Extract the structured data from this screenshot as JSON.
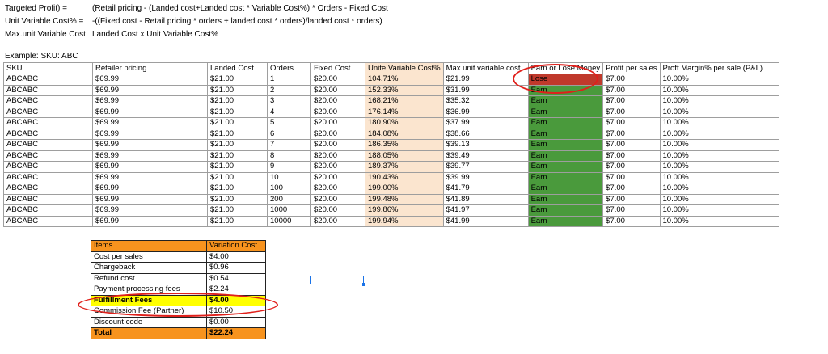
{
  "formulas": [
    {
      "label": "Targeted Profit) =",
      "value": "(Retail pricing - (Landed cost+Landed cost * Variable Cost%) * Orders - Fixed Cost"
    },
    {
      "label": "Unit Variable Cost% =",
      "value": "-((Fixed cost - Retail pricing * orders + landed cost * orders)/landed cost * orders)"
    },
    {
      "label": "Max.unit Variable Cost",
      "value": "Landed Cost x Unit Variable Cost%"
    }
  ],
  "example_label": "Example: SKU: ABC",
  "main_table": {
    "headers": [
      "SKU",
      "Retailer pricing",
      "Landed Cost",
      "Orders",
      "Fixed Cost",
      "Unite Variable Cost%",
      "Max.unit variable cost",
      "Earn or Lose Money",
      "Profit per sales",
      "Proft Margin% per sale (P&L)"
    ],
    "rows": [
      [
        "ABCABC",
        "$69.99",
        "$21.00",
        "1",
        "$20.00",
        "104.71%",
        "$21.99",
        "Lose",
        "$7.00",
        "10.00%"
      ],
      [
        "ABCABC",
        "$69.99",
        "$21.00",
        "2",
        "$20.00",
        "152.33%",
        "$31.99",
        "Earn",
        "$7.00",
        "10.00%"
      ],
      [
        "ABCABC",
        "$69.99",
        "$21.00",
        "3",
        "$20.00",
        "168.21%",
        "$35.32",
        "Earn",
        "$7.00",
        "10.00%"
      ],
      [
        "ABCABC",
        "$69.99",
        "$21.00",
        "4",
        "$20.00",
        "176.14%",
        "$36.99",
        "Earn",
        "$7.00",
        "10.00%"
      ],
      [
        "ABCABC",
        "$69.99",
        "$21.00",
        "5",
        "$20.00",
        "180.90%",
        "$37.99",
        "Earn",
        "$7.00",
        "10.00%"
      ],
      [
        "ABCABC",
        "$69.99",
        "$21.00",
        "6",
        "$20.00",
        "184.08%",
        "$38.66",
        "Earn",
        "$7.00",
        "10.00%"
      ],
      [
        "ABCABC",
        "$69.99",
        "$21.00",
        "7",
        "$20.00",
        "186.35%",
        "$39.13",
        "Earn",
        "$7.00",
        "10.00%"
      ],
      [
        "ABCABC",
        "$69.99",
        "$21.00",
        "8",
        "$20.00",
        "188.05%",
        "$39.49",
        "Earn",
        "$7.00",
        "10.00%"
      ],
      [
        "ABCABC",
        "$69.99",
        "$21.00",
        "9",
        "$20.00",
        "189.37%",
        "$39.77",
        "Earn",
        "$7.00",
        "10.00%"
      ],
      [
        "ABCABC",
        "$69.99",
        "$21.00",
        "10",
        "$20.00",
        "190.43%",
        "$39.99",
        "Earn",
        "$7.00",
        "10.00%"
      ],
      [
        "ABCABC",
        "$69.99",
        "$21.00",
        "100",
        "$20.00",
        "199.00%",
        "$41.79",
        "Earn",
        "$7.00",
        "10.00%"
      ],
      [
        "ABCABC",
        "$69.99",
        "$21.00",
        "200",
        "$20.00",
        "199.48%",
        "$41.89",
        "Earn",
        "$7.00",
        "10.00%"
      ],
      [
        "ABCABC",
        "$69.99",
        "$21.00",
        "1000",
        "$20.00",
        "199.86%",
        "$41.97",
        "Earn",
        "$7.00",
        "10.00%"
      ],
      [
        "ABCABC",
        "$69.99",
        "$21.00",
        "10000",
        "$20.00",
        "199.94%",
        "$41.99",
        "Earn",
        "$7.00",
        "10.00%"
      ]
    ]
  },
  "cost_table": {
    "headers": [
      "Items",
      "Variation Cost"
    ],
    "rows": [
      [
        "Cost per sales",
        "$4.00"
      ],
      [
        "Chargeback",
        "$0.96"
      ],
      [
        "Refund cost",
        "$0.54"
      ],
      [
        "Payment processing fees",
        "$2.24"
      ],
      [
        "Fulfillment Fees",
        "$4.00"
      ],
      [
        "Commission Fee (Partner)",
        "$10.50"
      ],
      [
        "Discount code",
        "$0.00"
      ]
    ],
    "highlight_row": 4,
    "total": [
      "Total",
      "$22.24"
    ]
  },
  "colors": {
    "peach": "#fbe5cf",
    "lose_red": "#c0392b",
    "earn_green": "#4a9a3c",
    "orange": "#f7931e",
    "yellow": "#ffff00",
    "annotation_red": "#e0201b",
    "selection_blue": "#1a73e8"
  }
}
